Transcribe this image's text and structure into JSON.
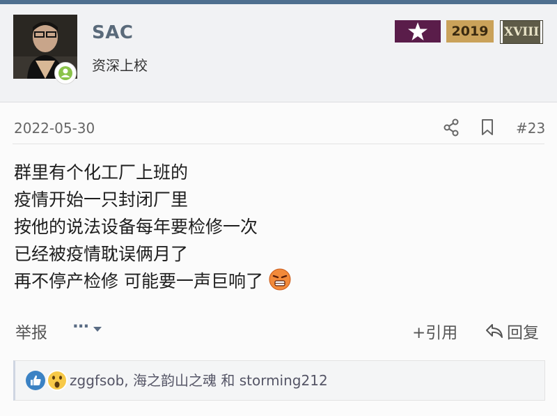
{
  "user": {
    "name": "SAC",
    "rank": "资深上校"
  },
  "medals": {
    "year": "2019",
    "roman": "XVIII"
  },
  "post": {
    "date": "2022-05-30",
    "floor": "#23",
    "lines": [
      "群里有个化工厂上班的",
      "疫情开始一只封闭厂里",
      "按他的说法设备每年要检修一次",
      "已经被疫情耽误俩月了",
      "再不停产检修 可能要一声巨响了"
    ]
  },
  "actions": {
    "report": "举报",
    "more": "···",
    "quote": "+引用",
    "reply": "回复"
  },
  "likes": {
    "text": "zggfsob, 海之韵山之魂 和 storming212"
  },
  "icons": {
    "share": "share-icon",
    "bookmark": "bookmark-icon",
    "reply": "reply-arrow-icon",
    "like": "thumbs-up-icon",
    "wow": "wow-face-icon",
    "emoji": "angry-face-emoji"
  },
  "colors": {
    "accent": "#4f6f8f",
    "username": "#5a6a7a",
    "online": "#8bc34a",
    "like_blue": "#3b82c4"
  }
}
